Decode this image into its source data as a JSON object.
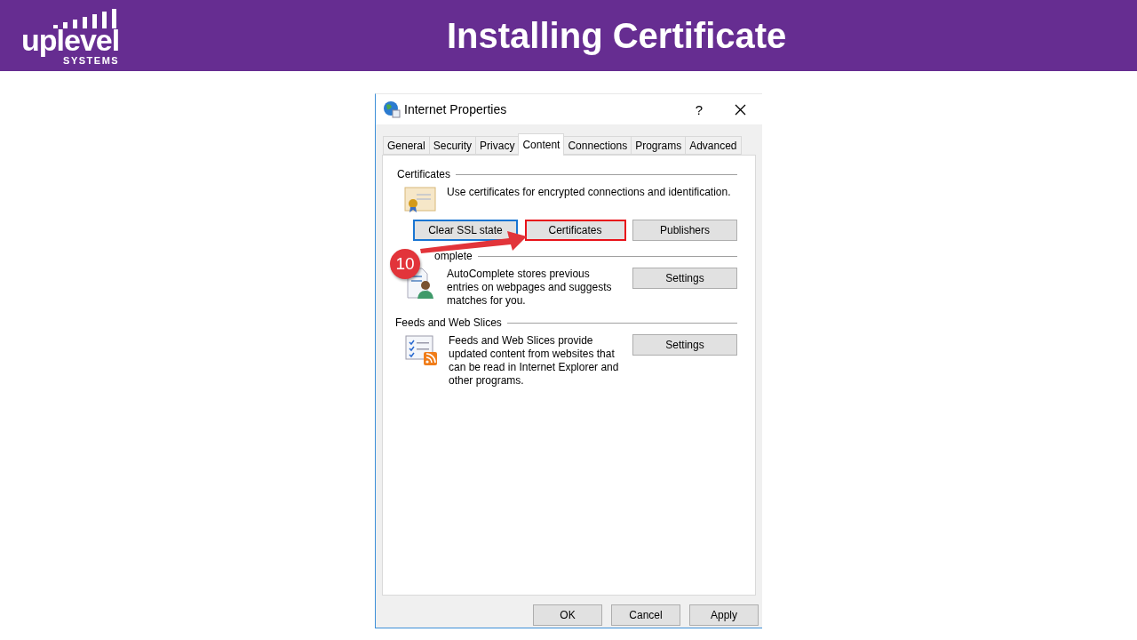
{
  "slide": {
    "logo": {
      "wordmark": "uplevel",
      "tagline": "SYSTEMS"
    },
    "title": "Installing Certificate"
  },
  "window": {
    "title": "Internet Properties",
    "help": "?",
    "tabs": [
      {
        "label": "General",
        "selected": false
      },
      {
        "label": "Security",
        "selected": false
      },
      {
        "label": "Privacy",
        "selected": false
      },
      {
        "label": "Content",
        "selected": true
      },
      {
        "label": "Connections",
        "selected": false
      },
      {
        "label": "Programs",
        "selected": false
      },
      {
        "label": "Advanced",
        "selected": false
      }
    ],
    "sections": [
      {
        "kind": "certificates",
        "heading": "Certificates",
        "text": "Use certificates for encrypted connections and identification.",
        "buttons": [
          {
            "label": "Clear SSL state",
            "focused": true,
            "highlighted": false
          },
          {
            "label": "Certificates",
            "focused": false,
            "highlighted": true
          },
          {
            "label": "Publishers",
            "focused": false,
            "highlighted": false
          }
        ]
      },
      {
        "kind": "autocomplete",
        "heading": "omplete",
        "text": "AutoComplete stores previous entries on webpages and suggests matches for you.",
        "buttons": [
          {
            "label": "Settings",
            "focused": false,
            "highlighted": false
          }
        ]
      },
      {
        "kind": "feeds",
        "heading": "Feeds and Web Slices",
        "text": "Feeds and Web Slices provide updated content from websites that can be read in Internet Explorer and other programs.",
        "buttons": [
          {
            "label": "Settings",
            "focused": false,
            "highlighted": false
          }
        ]
      }
    ],
    "footer_buttons": [
      "OK",
      "Cancel",
      "Apply"
    ]
  },
  "annotation": {
    "step": "10"
  }
}
